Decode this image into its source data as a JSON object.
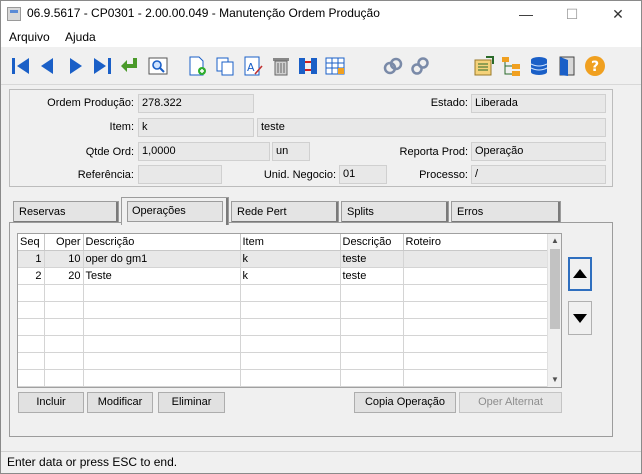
{
  "window": {
    "title": "06.9.5617 - CP0301 - 2.00.00.049 - Manutenção Ordem Produção",
    "min_glyph": "—",
    "max_glyph": "☐",
    "close_glyph": "✕"
  },
  "menu": {
    "items": [
      {
        "label": "Arquivo"
      },
      {
        "label": "Ajuda"
      }
    ]
  },
  "toolbar": {
    "icons": [
      "first-record-icon",
      "previous-record-icon",
      "next-record-icon",
      "last-record-icon",
      "goto-return-icon",
      "search-zoom-icon",
      "new-document-icon",
      "copy-icon",
      "edit-text-icon",
      "delete-trash-icon",
      "swap-icon",
      "grid-icon",
      "link-icon",
      "chain-icon",
      "report-icon",
      "tree-icon",
      "database-icon",
      "exit-door-icon",
      "help-icon"
    ]
  },
  "header": {
    "ordem_label": "Ordem Produção:",
    "ordem_value": "278.322",
    "estado_label": "Estado:",
    "estado_value": "Liberada",
    "item_label": "Item:",
    "item_code": "k",
    "item_desc": "teste",
    "qtde_label": "Qtde Ord:",
    "qtde_value": "1,0000",
    "qtde_unit": "un",
    "reporta_label": "Reporta Prod:",
    "reporta_value": "Operação",
    "referencia_label": "Referência:",
    "referencia_value": "",
    "unid_label": "Unid. Negocio:",
    "unid_value": "01",
    "processo_label": "Processo:",
    "processo_value": "/"
  },
  "tabs": [
    {
      "label": "Reservas"
    },
    {
      "label": "Operações"
    },
    {
      "label": "Rede Pert"
    },
    {
      "label": "Splits"
    },
    {
      "label": "Erros"
    }
  ],
  "grid": {
    "columns": [
      "Seq",
      "Oper",
      "Descrição",
      "Item",
      "Descrição",
      "Roteiro"
    ],
    "rows": [
      [
        "1",
        "10",
        "oper do gm1",
        "k",
        "teste",
        ""
      ],
      [
        "2",
        "20",
        "Teste",
        "k",
        "teste",
        ""
      ]
    ]
  },
  "buttons": {
    "incluir": "Incluir",
    "modificar": "Modificar",
    "eliminar": "Eliminar",
    "copia": "Copia Operação",
    "oper_alternat": "Oper Alternat"
  },
  "status": {
    "text": "Enter data or press ESC to end."
  },
  "colors": {
    "accent_blue": "#2f6fbf",
    "help_orange": "#f0a020",
    "nav_blue": "#1a5fc7",
    "return_green": "#4a9a2a"
  }
}
